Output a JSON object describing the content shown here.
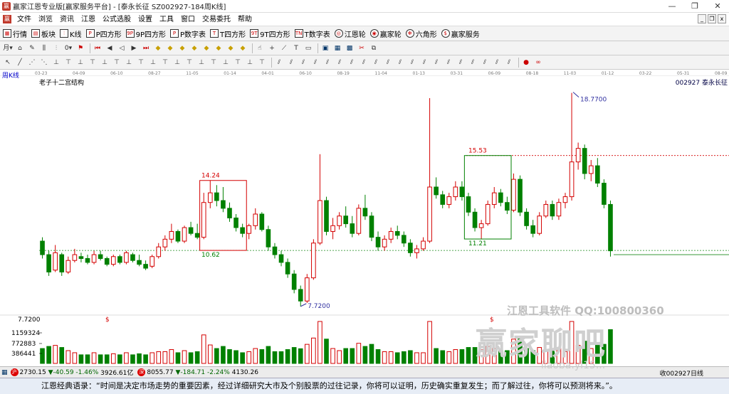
{
  "window": {
    "title": "赢家江恩专业版[赢家服务平台] - [泰永长征  SZ002927-184周K线]",
    "controls": [
      "—",
      "❐",
      "✕"
    ]
  },
  "menu": {
    "items": [
      "文件",
      "浏览",
      "资讯",
      "江恩",
      "公式选股",
      "设置",
      "工具",
      "窗口",
      "交易委托",
      "帮助"
    ],
    "mdi_controls": [
      "_",
      "❐",
      "x"
    ]
  },
  "toolbar1": {
    "buttons": [
      {
        "label": "行情",
        "icon": "grid-icon"
      },
      {
        "label": "板块",
        "icon": "blocks-icon"
      },
      {
        "label": "K线",
        "icon": "kline-icon"
      },
      {
        "label": "P四方形",
        "icon": "p-square-icon"
      },
      {
        "label": "9P四方形",
        "icon": "9p-square-icon"
      },
      {
        "label": "P数字表",
        "icon": "p-table-icon"
      },
      {
        "label": "T四方形",
        "icon": "t-square-icon"
      },
      {
        "label": "9T四方形",
        "icon": "9t-square-icon"
      },
      {
        "label": "T数字表",
        "icon": "t-table-icon"
      },
      {
        "label": "江恩轮",
        "icon": "gann-wheel-icon"
      },
      {
        "label": "赢家轮",
        "icon": "winner-wheel-icon"
      },
      {
        "label": "六角形",
        "icon": "hexagon-icon"
      },
      {
        "label": "赢家服务",
        "icon": "service-icon"
      }
    ]
  },
  "chart_header": {
    "period_label": "周K线",
    "indicator_name": "老子十二宫结构",
    "stock_code_label": "002927 泰永长征",
    "date_ticks": [
      "03-23",
      "04-09",
      "06-10",
      "08-27",
      "11-05",
      "01-14",
      "04-01",
      "06-10",
      "08-19",
      "11-04",
      "01-13",
      "03-31",
      "06-09",
      "08-18",
      "11-03",
      "01-12",
      "03-22",
      "05-31",
      "08-09"
    ]
  },
  "chart_data": {
    "type": "candlestick",
    "title": "老子十二宫结构",
    "annotations": [
      {
        "text": "18.7700",
        "kind": "high-marker"
      },
      {
        "text": "15.53",
        "kind": "box-top"
      },
      {
        "text": "14.24",
        "kind": "box-top"
      },
      {
        "text": "11.21",
        "kind": "box-bottom"
      },
      {
        "text": "10.62",
        "kind": "box-bottom"
      },
      {
        "text": "7.7200",
        "kind": "low-marker"
      },
      {
        "text": "$",
        "kind": "signal"
      },
      {
        "text": "$",
        "kind": "signal"
      }
    ],
    "price_axis_label": "7.7200",
    "volume_axis_labels": [
      "1159324",
      "772883",
      "386441"
    ],
    "price_range": [
      7.2,
      19.2
    ],
    "candles_ohlc": [
      [
        11.1,
        11.3,
        10.2,
        10.4
      ],
      [
        10.4,
        10.6,
        9.3,
        9.5
      ],
      [
        9.6,
        10.9,
        9.5,
        10.5
      ],
      [
        10.4,
        10.5,
        9.3,
        9.5
      ],
      [
        9.5,
        10.3,
        9.4,
        10.1
      ],
      [
        10.1,
        10.7,
        10.0,
        10.4
      ],
      [
        10.3,
        10.5,
        10.0,
        10.2
      ],
      [
        10.2,
        10.4,
        9.9,
        10.0
      ],
      [
        10.0,
        10.6,
        9.9,
        10.4
      ],
      [
        10.4,
        10.6,
        10.1,
        10.2
      ],
      [
        10.2,
        10.3,
        9.8,
        9.9
      ],
      [
        9.9,
        10.4,
        9.8,
        10.3
      ],
      [
        10.3,
        10.4,
        9.9,
        10.0
      ],
      [
        10.0,
        10.6,
        9.9,
        10.5
      ],
      [
        10.4,
        10.5,
        10.0,
        10.1
      ],
      [
        10.1,
        10.4,
        9.8,
        9.9
      ],
      [
        9.9,
        10.1,
        9.6,
        9.7
      ],
      [
        9.8,
        10.4,
        9.7,
        10.3
      ],
      [
        10.3,
        11.0,
        10.2,
        10.8
      ],
      [
        10.8,
        11.4,
        10.6,
        11.2
      ],
      [
        11.2,
        12.0,
        11.0,
        11.6
      ],
      [
        11.6,
        11.7,
        11.0,
        11.1
      ],
      [
        11.1,
        11.9,
        11.0,
        11.8
      ],
      [
        11.8,
        12.1,
        11.4,
        11.5
      ],
      [
        11.5,
        12.0,
        11.2,
        11.3
      ],
      [
        11.3,
        13.6,
        11.2,
        13.1
      ],
      [
        13.1,
        14.24,
        12.8,
        13.6
      ],
      [
        13.6,
        14.0,
        12.9,
        13.2
      ],
      [
        13.2,
        13.9,
        12.6,
        12.8
      ],
      [
        12.8,
        13.1,
        12.1,
        12.3
      ],
      [
        12.3,
        12.5,
        11.6,
        11.8
      ],
      [
        11.8,
        12.0,
        11.3,
        11.5
      ],
      [
        11.5,
        12.0,
        11.2,
        11.9
      ],
      [
        11.9,
        12.8,
        11.7,
        12.5
      ],
      [
        12.5,
        12.6,
        11.6,
        11.7
      ],
      [
        11.7,
        11.9,
        10.6,
        10.8
      ],
      [
        10.8,
        11.0,
        10.2,
        10.4
      ],
      [
        10.4,
        10.6,
        9.8,
        10.0
      ],
      [
        10.0,
        10.2,
        9.2,
        9.4
      ],
      [
        9.4,
        9.6,
        8.4,
        8.6
      ],
      [
        8.6,
        8.8,
        7.72,
        8.0
      ],
      [
        8.0,
        9.4,
        7.9,
        9.2
      ],
      [
        9.2,
        11.2,
        9.1,
        11.0
      ],
      [
        11.0,
        15.6,
        10.9,
        13.2
      ],
      [
        13.2,
        13.4,
        11.4,
        11.6
      ],
      [
        11.6,
        12.3,
        11.2,
        11.9
      ],
      [
        11.9,
        12.6,
        11.7,
        12.4
      ],
      [
        12.4,
        12.9,
        11.8,
        12.0
      ],
      [
        12.0,
        12.4,
        11.3,
        11.5
      ],
      [
        11.5,
        13.0,
        11.4,
        12.8
      ],
      [
        12.8,
        13.5,
        12.2,
        12.4
      ],
      [
        12.4,
        12.6,
        11.1,
        11.3
      ],
      [
        11.3,
        11.6,
        10.6,
        10.8
      ],
      [
        10.8,
        11.4,
        10.6,
        11.2
      ],
      [
        11.2,
        11.8,
        11.0,
        11.6
      ],
      [
        11.6,
        11.9,
        11.2,
        11.4
      ],
      [
        11.4,
        11.6,
        10.8,
        11.0
      ],
      [
        11.0,
        11.2,
        10.3,
        10.5
      ],
      [
        10.5,
        10.9,
        10.2,
        10.7
      ],
      [
        10.7,
        11.3,
        10.6,
        11.1
      ],
      [
        11.1,
        18.5,
        11.0,
        13.9
      ],
      [
        13.9,
        14.4,
        13.3,
        13.5
      ],
      [
        13.5,
        13.7,
        12.8,
        13.0
      ],
      [
        13.0,
        13.6,
        12.8,
        13.4
      ],
      [
        13.4,
        14.2,
        13.2,
        13.9
      ],
      [
        13.9,
        14.2,
        13.2,
        13.4
      ],
      [
        13.4,
        13.6,
        12.4,
        12.6
      ],
      [
        12.6,
        12.8,
        11.6,
        11.8
      ],
      [
        11.8,
        12.2,
        11.21,
        12.0
      ],
      [
        12.0,
        13.2,
        11.9,
        13.0
      ],
      [
        13.0,
        13.9,
        12.8,
        13.6
      ],
      [
        13.6,
        13.8,
        12.9,
        13.1
      ],
      [
        13.1,
        13.4,
        12.5,
        12.7
      ],
      [
        12.7,
        14.6,
        12.6,
        14.3
      ],
      [
        14.3,
        14.5,
        12.4,
        12.6
      ],
      [
        12.6,
        12.8,
        11.7,
        11.9
      ],
      [
        11.9,
        12.2,
        11.3,
        11.5
      ],
      [
        11.5,
        12.6,
        11.4,
        12.4
      ],
      [
        12.4,
        13.2,
        12.3,
        13.0
      ],
      [
        13.0,
        13.2,
        12.2,
        12.4
      ],
      [
        12.4,
        13.3,
        12.2,
        13.1
      ],
      [
        13.1,
        13.6,
        12.8,
        13.4
      ],
      [
        13.4,
        18.77,
        13.2,
        15.2
      ],
      [
        15.2,
        16.2,
        14.8,
        15.9
      ],
      [
        15.9,
        16.1,
        14.3,
        14.6
      ],
      [
        14.6,
        15.3,
        14.2,
        15.0
      ],
      [
        15.0,
        15.4,
        13.9,
        14.1
      ],
      [
        14.1,
        14.3,
        12.8,
        13.0
      ],
      [
        13.0,
        13.2,
        10.3,
        10.6
      ]
    ]
  },
  "status": {
    "sh_index": "2730.15",
    "sh_change": "▼-40.59",
    "sh_pct": "-1.46%",
    "sh_amount": "3926.61亿",
    "sz_index": "8055.77",
    "sz_change": "▼-184.71",
    "sz_pct": "-2.24%",
    "sz_amount": "4130.26",
    "right_text": "收002927日线"
  },
  "quote_bar": {
    "text": "江恩经典语录：“时间是决定市场走势的重要因素，经过详细研究大市及个别股票的过往记录，你将可以证明，历史确实重复发生；而了解过往，你将可以预测将来。”。"
  },
  "watermark": {
    "line1": "江恩工具软件  QQ:100800360",
    "line2": "赢家聊吧",
    "line3": "liaoba.yl15..."
  },
  "colors": {
    "up": "#d40000",
    "down": "#008000",
    "box_up": "#d40000",
    "box_down": "#008000",
    "marker": "#3030a0"
  }
}
